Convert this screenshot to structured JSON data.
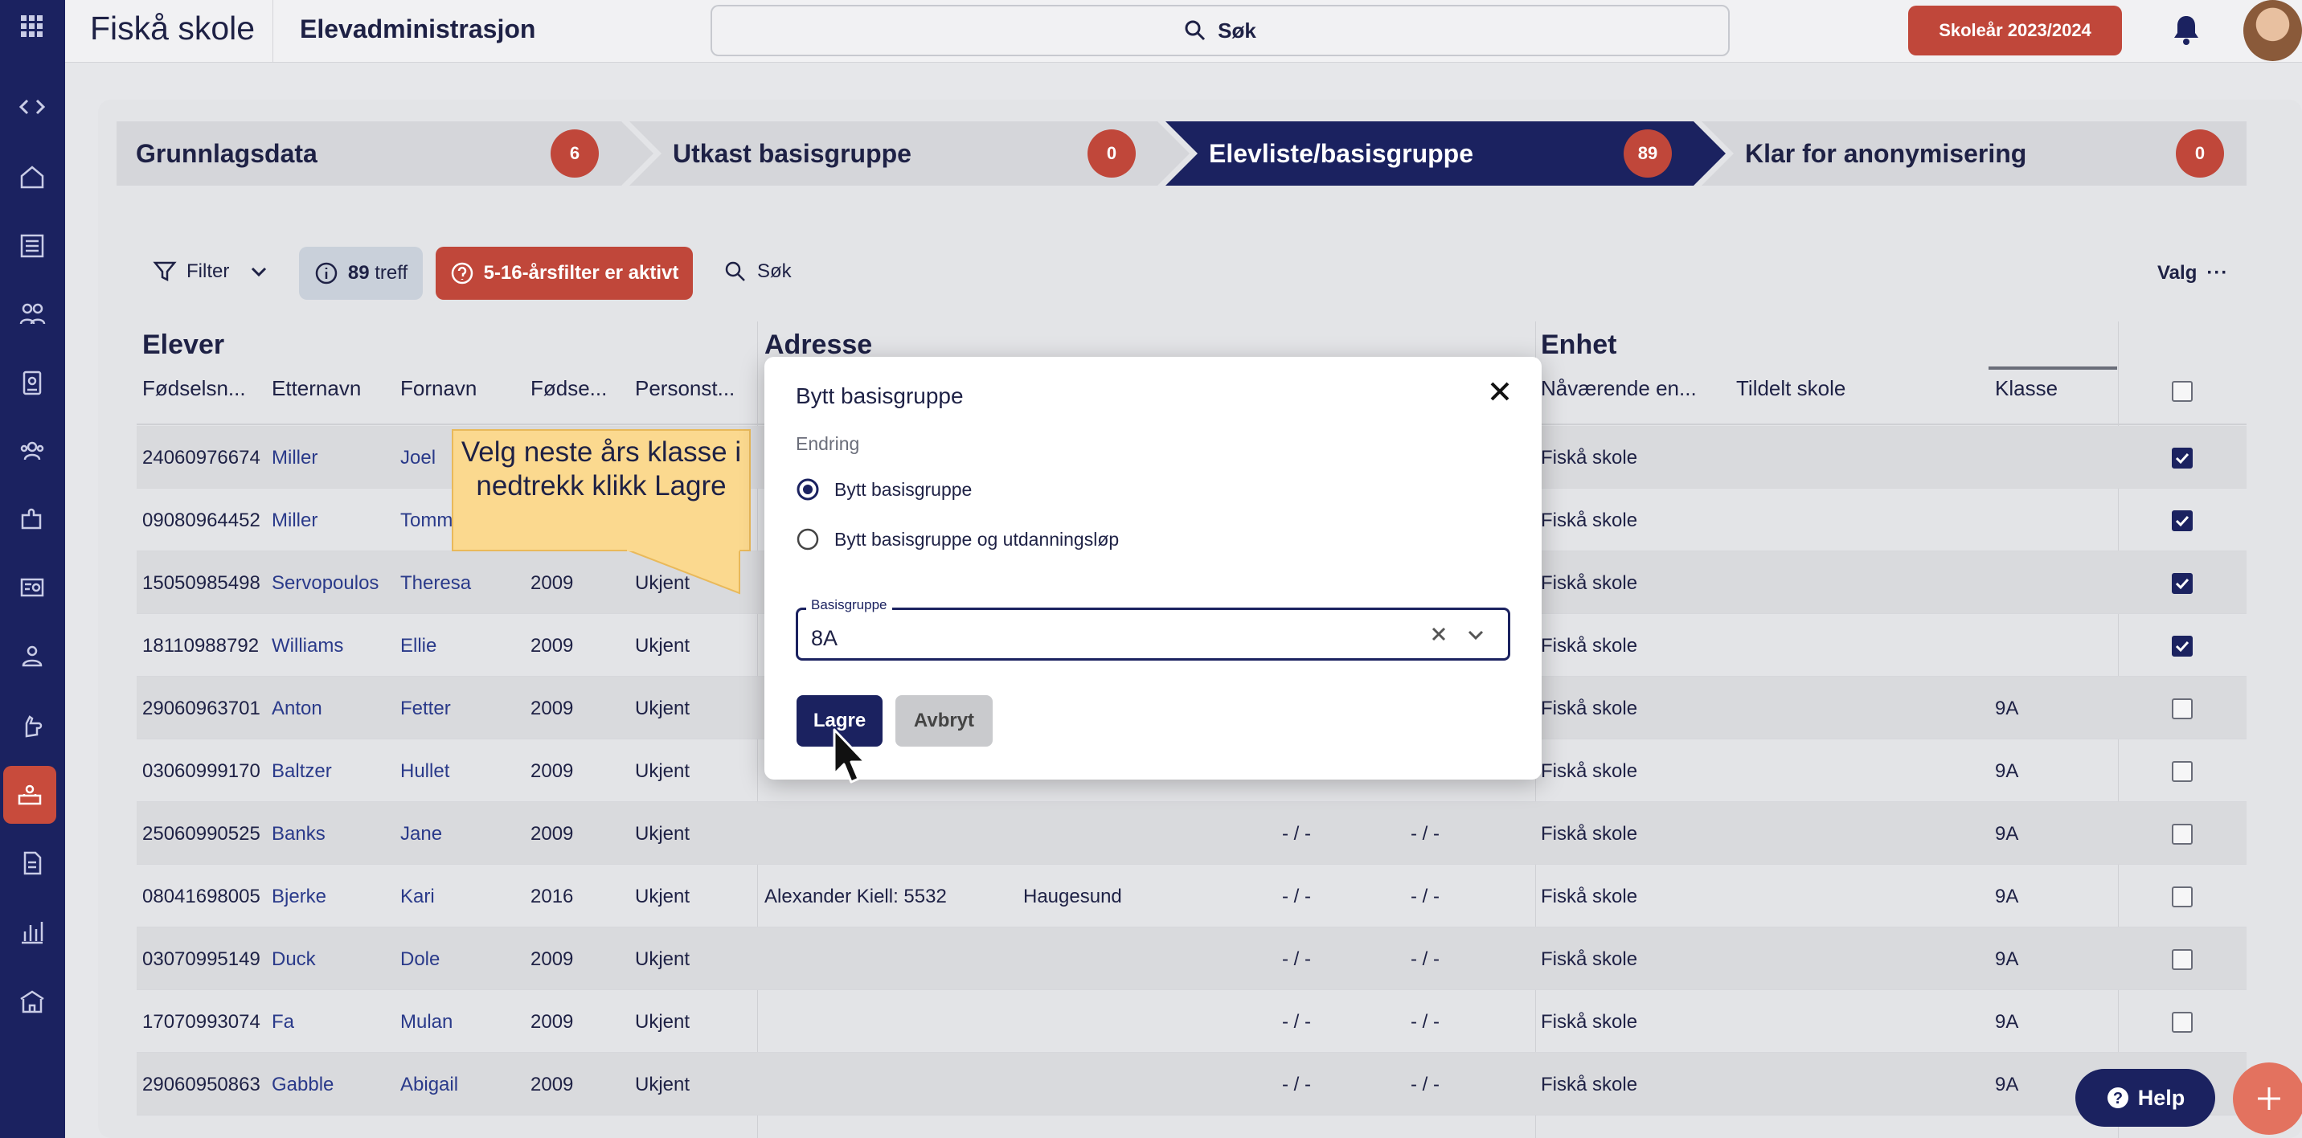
{
  "topbar": {
    "school": "Fiskå skole",
    "app_title": "Elevadministrasjon",
    "search_label": "Søk",
    "school_year": "Skoleår 2023/2024"
  },
  "steps": [
    {
      "label": "Grunnlagsdata",
      "count": "6"
    },
    {
      "label": "Utkast basisgruppe",
      "count": "0"
    },
    {
      "label": "Elevliste/basisgruppe",
      "count": "89"
    },
    {
      "label": "Klar for anonymisering",
      "count": "0"
    }
  ],
  "toolbar": {
    "filter": "Filter",
    "treff_count": "89",
    "treff_label": "treff",
    "age_filter": "5-16-årsfilter er aktivt",
    "search": "Søk",
    "valg": "Valg"
  },
  "table": {
    "groups": {
      "elever": "Elever",
      "adresse": "Adresse",
      "enhet": "Enhet"
    },
    "columns": {
      "fnr": "Fødselsn...",
      "etternavn": "Etternavn",
      "fornavn": "Fornavn",
      "fodsel": "Fødse...",
      "personstatus": "Personst...",
      "naavaerende": "Nåværende en...",
      "tildelt": "Tildelt skole",
      "klasse": "Klasse"
    },
    "rows": [
      {
        "fnr": "24060976674",
        "etternavn": "Miller",
        "fornavn": "Joel",
        "aar": "",
        "status": "",
        "adresse": "",
        "sted": "",
        "d1": "",
        "d2": "",
        "enhet": "Fiskå skole",
        "klasse": "",
        "checked": true
      },
      {
        "fnr": "09080964452",
        "etternavn": "Miller",
        "fornavn": "Tomm",
        "aar": "",
        "status": "",
        "adresse": "",
        "sted": "",
        "d1": "",
        "d2": "",
        "enhet": "Fiskå skole",
        "klasse": "",
        "checked": true
      },
      {
        "fnr": "15050985498",
        "etternavn": "Servopoulos",
        "fornavn": "Theresa",
        "aar": "2009",
        "status": "Ukjent",
        "adresse": "",
        "sted": "",
        "d1": "",
        "d2": "",
        "enhet": "Fiskå skole",
        "klasse": "",
        "checked": true
      },
      {
        "fnr": "18110988792",
        "etternavn": "Williams",
        "fornavn": "Ellie",
        "aar": "2009",
        "status": "Ukjent",
        "adresse": "",
        "sted": "",
        "d1": "",
        "d2": "",
        "enhet": "Fiskå skole",
        "klasse": "",
        "checked": true
      },
      {
        "fnr": "29060963701",
        "etternavn": "Anton",
        "fornavn": "Fetter",
        "aar": "2009",
        "status": "Ukjent",
        "adresse": "",
        "sted": "",
        "d1": "",
        "d2": "",
        "enhet": "Fiskå skole",
        "klasse": "9A",
        "checked": false
      },
      {
        "fnr": "03060999170",
        "etternavn": "Baltzer",
        "fornavn": "Hullet",
        "aar": "2009",
        "status": "Ukjent",
        "adresse": "",
        "sted": "",
        "d1": "",
        "d2": "",
        "enhet": "Fiskå skole",
        "klasse": "9A",
        "checked": false
      },
      {
        "fnr": "25060990525",
        "etternavn": "Banks",
        "fornavn": "Jane",
        "aar": "2009",
        "status": "Ukjent",
        "adresse": "",
        "sted": "",
        "d1": "- / -",
        "d2": "- / -",
        "enhet": "Fiskå skole",
        "klasse": "9A",
        "checked": false
      },
      {
        "fnr": "08041698005",
        "etternavn": "Bjerke",
        "fornavn": "Kari",
        "aar": "2016",
        "status": "Ukjent",
        "adresse": "Alexander Kiell: 5532",
        "sted": "Haugesund",
        "d1": "- / -",
        "d2": "- / -",
        "enhet": "Fiskå skole",
        "klasse": "9A",
        "checked": false
      },
      {
        "fnr": "03070995149",
        "etternavn": "Duck",
        "fornavn": "Dole",
        "aar": "2009",
        "status": "Ukjent",
        "adresse": "",
        "sted": "",
        "d1": "- / -",
        "d2": "- / -",
        "enhet": "Fiskå skole",
        "klasse": "9A",
        "checked": false
      },
      {
        "fnr": "17070993074",
        "etternavn": "Fa",
        "fornavn": "Mulan",
        "aar": "2009",
        "status": "Ukjent",
        "adresse": "",
        "sted": "",
        "d1": "- / -",
        "d2": "- / -",
        "enhet": "Fiskå skole",
        "klasse": "9A",
        "checked": false
      },
      {
        "fnr": "29060950863",
        "etternavn": "Gabble",
        "fornavn": "Abigail",
        "aar": "2009",
        "status": "Ukjent",
        "adresse": "",
        "sted": "",
        "d1": "- / -",
        "d2": "- / -",
        "enhet": "Fiskå skole",
        "klasse": "9A",
        "checked": false
      }
    ]
  },
  "modal": {
    "title": "Bytt basisgruppe",
    "section": "Endring",
    "option1": "Bytt basisgruppe",
    "option2": "Bytt basisgruppe og utdanningsløp",
    "field_label": "Basisgruppe",
    "field_value": "8A",
    "save": "Lagre",
    "cancel": "Avbryt"
  },
  "callout": "Velg neste års klasse i nedtrekk klikk Lagre",
  "help": "Help",
  "colors": {
    "navy": "#1b2260",
    "accent": "#c0473a",
    "callout": "#fbd98f"
  }
}
